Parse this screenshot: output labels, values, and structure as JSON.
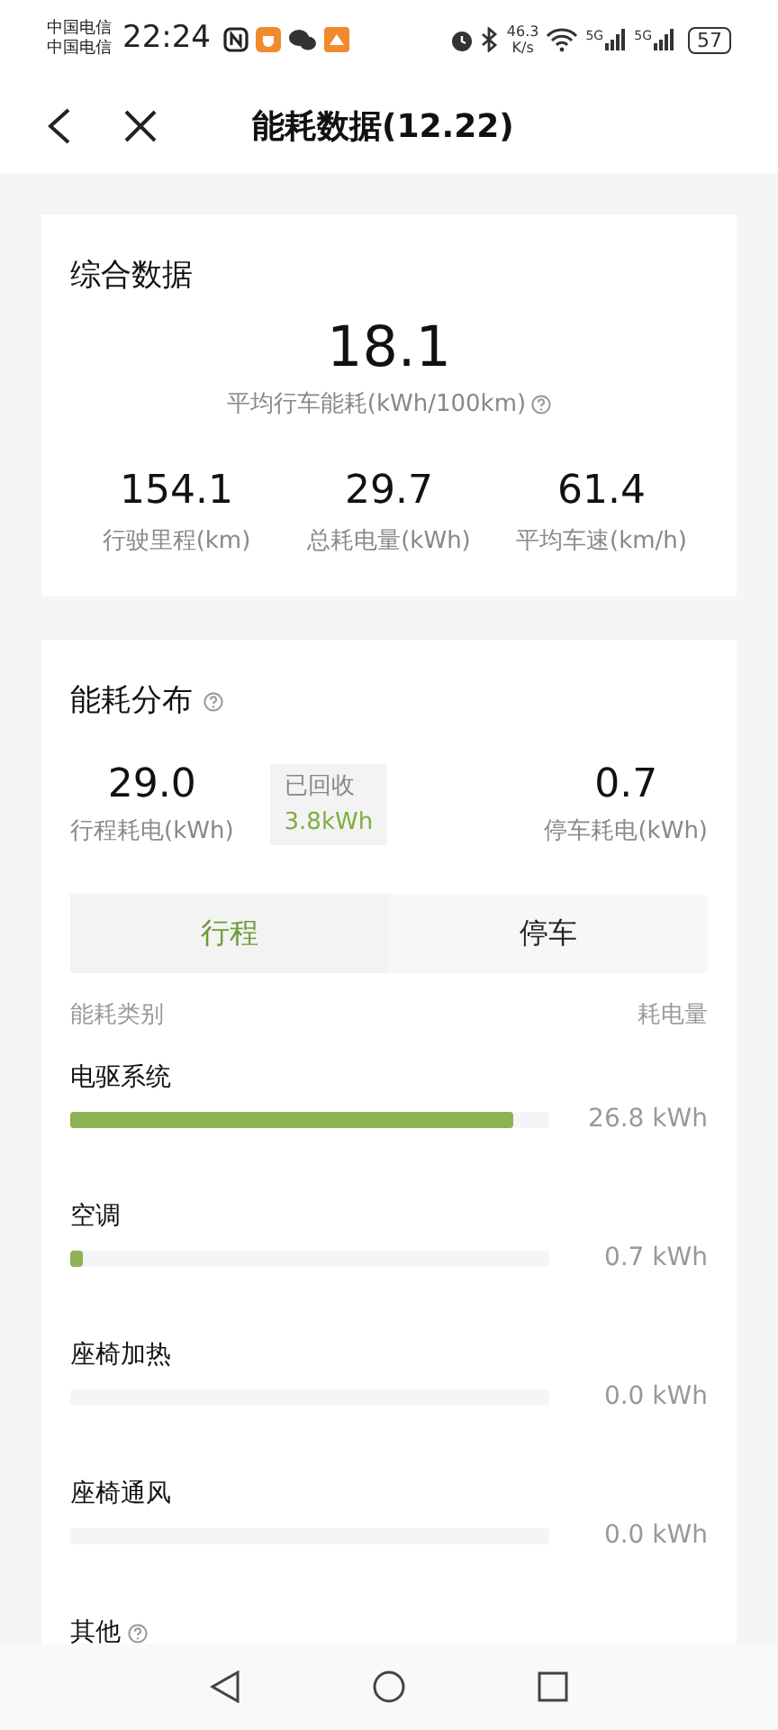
{
  "status_bar": {
    "carriers": [
      "中国电信",
      "中国电信"
    ],
    "time": "22:24",
    "speed": "46.3",
    "speed_unit": "K/s",
    "networks": [
      "5G",
      "5G"
    ],
    "battery": "57"
  },
  "header": {
    "title": "能耗数据(12.22)"
  },
  "summary": {
    "title": "综合数据",
    "main_value": "18.1",
    "main_label": "平均行车能耗(kWh/100km)",
    "stats": [
      {
        "value": "154.1",
        "label": "行驶里程(km)"
      },
      {
        "value": "29.7",
        "label": "总耗电量(kWh)"
      },
      {
        "value": "61.4",
        "label": "平均车速(km/h)"
      }
    ]
  },
  "distribution": {
    "title": "能耗分布",
    "trip": {
      "value": "29.0",
      "label": "行程耗电(kWh)"
    },
    "recovered": {
      "label": "已回收",
      "value": "3.8kWh"
    },
    "parking": {
      "value": "0.7",
      "label": "停车耗电(kWh)"
    },
    "tabs": [
      {
        "label": "行程",
        "selected": true
      },
      {
        "label": "停车",
        "selected": false
      }
    ],
    "columns": [
      "能耗类别",
      "耗电量"
    ],
    "rows": [
      {
        "name": "电驱系统",
        "level": 0.925,
        "reading": "26.8 kWh"
      },
      {
        "name": "空调",
        "level": 0.025,
        "reading": "0.7 kWh"
      },
      {
        "name": "座椅加热",
        "reading": "0.0 kWh"
      },
      {
        "name": "座椅通风",
        "reading": "0.0 kWh"
      },
      {
        "name": "其他",
        "info": true
      }
    ]
  }
}
